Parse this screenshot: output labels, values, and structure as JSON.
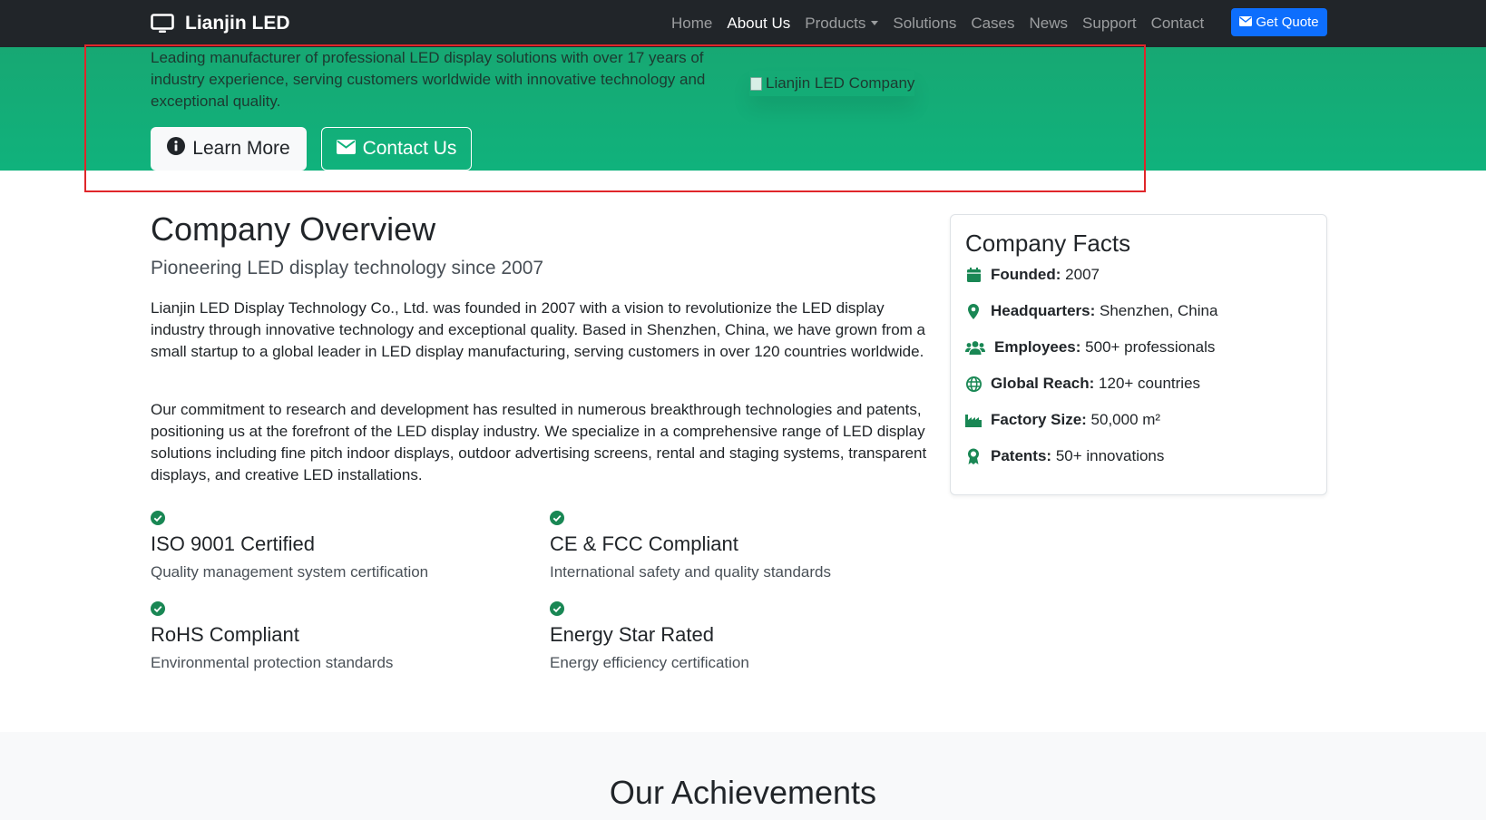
{
  "navbar": {
    "brand": "Lianjin LED",
    "brand_icon": "monitor-icon",
    "links": [
      "Home",
      "About Us",
      "Products",
      "Solutions",
      "Cases",
      "News",
      "Support",
      "Contact"
    ],
    "active_link": "About Us",
    "quote_button": "Get Quote",
    "quote_icon": "envelope-icon",
    "background": "#212529",
    "accent": "#0d6efd"
  },
  "hero": {
    "background": "#10b27c",
    "text": "Leading manufacturer of professional LED display solutions with over 17 years of industry experience, serving customers worldwide with innovative technology and exceptional quality.",
    "image_alt": "Lianjin LED Company",
    "learn_more": "Learn More",
    "learn_more_icon": "info-circle-icon",
    "contact_us": "Contact Us",
    "contact_us_icon": "envelope-icon"
  },
  "overview": {
    "title": "Company Overview",
    "lead": "Pioneering LED display technology since 2007",
    "paragraphs": [
      "Lianjin LED Display Technology Co., Ltd. was founded in 2007 with a vision to revolutionize the LED display industry through innovative technology and exceptional quality. Based in Shenzhen, China, we have grown from a small startup to a global leader in LED display manufacturing, serving customers in over 120 countries worldwide.",
      "Our commitment to research and development has resulted in numerous breakthrough technologies and patents, positioning us at the forefront of the LED display industry. We specialize in a comprehensive range of LED display solutions including fine pitch indoor displays, outdoor advertising screens, rental and staging systems, transparent displays, and creative LED installations."
    ],
    "certifications": [
      {
        "title": "ISO 9001 Certified",
        "desc": "Quality management system certification",
        "icon": "check-circle-icon"
      },
      {
        "title": "CE & FCC Compliant",
        "desc": "International safety and quality standards",
        "icon": "check-circle-icon"
      },
      {
        "title": "RoHS Compliant",
        "desc": "Environmental protection standards",
        "icon": "check-circle-icon"
      },
      {
        "title": "Energy Star Rated",
        "desc": "Energy efficiency certification",
        "icon": "check-circle-icon"
      }
    ]
  },
  "facts": {
    "title": "Company Facts",
    "items": [
      {
        "label": "Founded:",
        "value": "2007",
        "icon": "calendar-icon"
      },
      {
        "label": "Headquarters:",
        "value": "Shenzhen, China",
        "icon": "map-pin-icon"
      },
      {
        "label": "Employees:",
        "value": "500+ professionals",
        "icon": "users-icon"
      },
      {
        "label": "Global Reach:",
        "value": "120+ countries",
        "icon": "globe-icon"
      },
      {
        "label": "Factory Size:",
        "value": "50,000 m²",
        "icon": "industry-icon"
      },
      {
        "label": "Patents:",
        "value": "50+ innovations",
        "icon": "award-icon"
      }
    ],
    "icon_color": "#198754"
  },
  "achievements": {
    "title": "Our Achievements"
  }
}
